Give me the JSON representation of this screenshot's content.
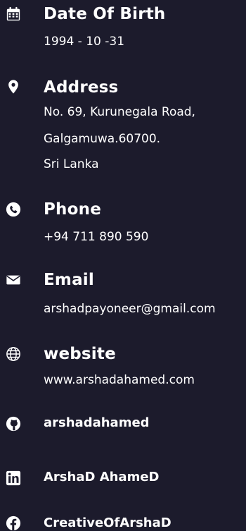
{
  "dob": {
    "title": "Date Of Birth",
    "value": "1994 - 10 -31",
    "icon": "calendar-icon"
  },
  "address": {
    "title": "Address",
    "lines": [
      "No. 69, Kurunegala Road,",
      "Galgamuwa.60700.",
      "Sri Lanka"
    ],
    "icon": "location-pin-icon"
  },
  "phone": {
    "title": "Phone",
    "value": "+94 711 890 590",
    "icon": "phone-icon"
  },
  "email": {
    "title": "Email",
    "value": "arshadpayoneer@gmail.com",
    "icon": "envelope-icon"
  },
  "website": {
    "title": "website",
    "value": "www.arshadahamed.com",
    "icon": "globe-icon"
  },
  "github": {
    "label": "arshadahamed",
    "icon": "github-icon"
  },
  "linkedin": {
    "label": "ArshaD AhameD",
    "icon": "linkedin-icon"
  },
  "facebook": {
    "label": "CreativeOfArshaD",
    "icon": "facebook-icon"
  },
  "colors": {
    "background": "#1c1b2c",
    "text": "#ffffff"
  }
}
